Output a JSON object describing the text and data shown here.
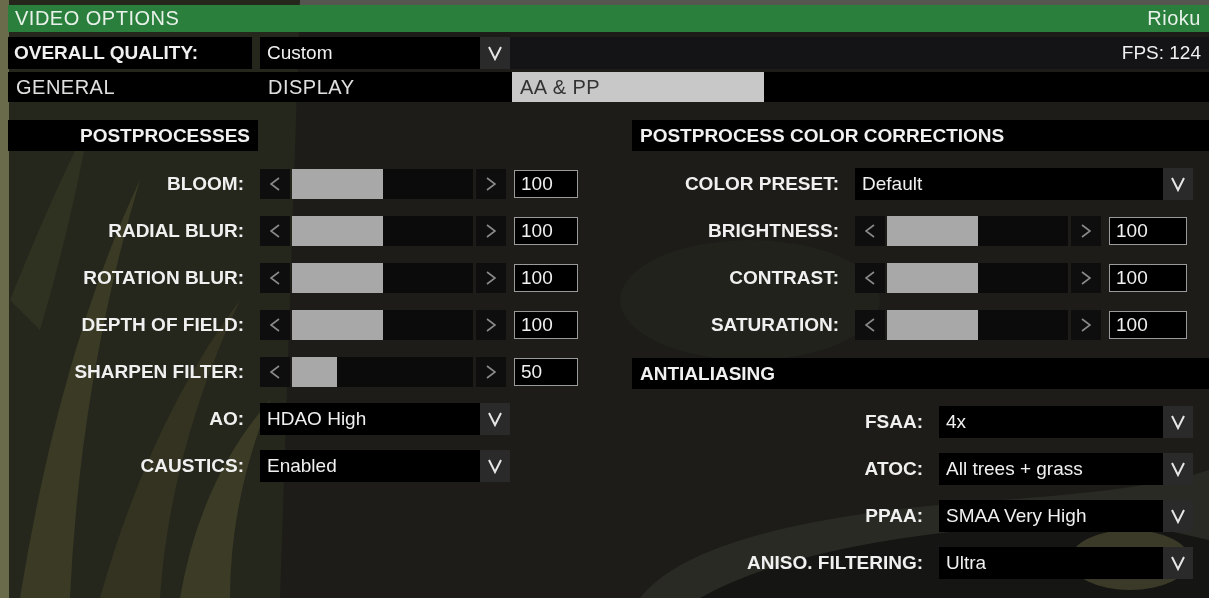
{
  "window": {
    "title": "VIDEO OPTIONS",
    "user": "Rioku"
  },
  "overall_quality": {
    "label": "OVERALL QUALITY:",
    "value": "Custom"
  },
  "fps": "FPS: 124",
  "tabs": [
    {
      "label": "GENERAL",
      "selected": false
    },
    {
      "label": "DISPLAY",
      "selected": false
    },
    {
      "label": "AA & PP",
      "selected": true
    }
  ],
  "postprocesses": {
    "heading": "POSTPROCESSES",
    "rows": [
      {
        "kind": "slider",
        "label": "BLOOM:",
        "level": 0.5,
        "value": "100"
      },
      {
        "kind": "slider",
        "label": "RADIAL BLUR:",
        "level": 0.5,
        "value": "100"
      },
      {
        "kind": "slider",
        "label": "ROTATION BLUR:",
        "level": 0.5,
        "value": "100"
      },
      {
        "kind": "slider",
        "label": "DEPTH OF FIELD:",
        "level": 0.5,
        "value": "100"
      },
      {
        "kind": "slider",
        "label": "SHARPEN FILTER:",
        "level": 0.25,
        "value": "50"
      },
      {
        "kind": "dropdown",
        "label": "AO:",
        "value": "HDAO High"
      },
      {
        "kind": "dropdown",
        "label": "CAUSTICS:",
        "value": "Enabled"
      }
    ]
  },
  "color_corrections": {
    "heading": "POSTPROCESS COLOR CORRECTIONS",
    "rows": [
      {
        "kind": "dropdown",
        "label": "COLOR PRESET:",
        "value": "Default"
      },
      {
        "kind": "slider",
        "label": "BRIGHTNESS:",
        "level": 0.5,
        "value": "100"
      },
      {
        "kind": "slider",
        "label": "CONTRAST:",
        "level": 0.5,
        "value": "100"
      },
      {
        "kind": "slider",
        "label": "SATURATION:",
        "level": 0.5,
        "value": "100"
      }
    ]
  },
  "antialiasing": {
    "heading": "ANTIALIASING",
    "rows": [
      {
        "kind": "dropdown",
        "label": "FSAA:",
        "value": "4x"
      },
      {
        "kind": "dropdown",
        "label": "ATOC:",
        "value": "All trees + grass"
      },
      {
        "kind": "dropdown",
        "label": "PPAA:",
        "value": "SMAA Very High"
      },
      {
        "kind": "dropdown",
        "label": "ANISO. FILTERING:",
        "value": "Ultra"
      }
    ]
  }
}
